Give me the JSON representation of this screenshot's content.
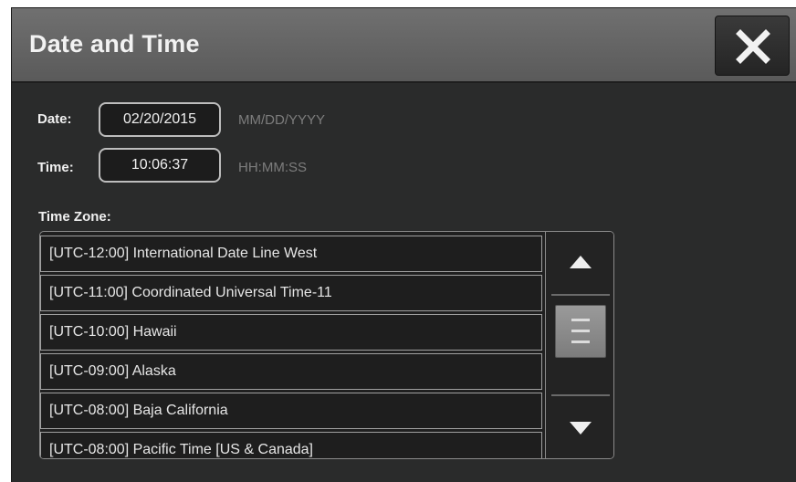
{
  "dialog": {
    "title": "Date and Time",
    "close_icon": "close-icon"
  },
  "date": {
    "label": "Date:",
    "value": "02/20/2015",
    "format_hint": "MM/DD/YYYY"
  },
  "time": {
    "label": "Time:",
    "value": "10:06:37",
    "format_hint": "HH:MM:SS"
  },
  "timezone": {
    "label": "Time Zone:",
    "items": [
      "[UTC-12:00] International Date Line West",
      "[UTC-11:00] Coordinated Universal Time-11",
      "[UTC-10:00] Hawaii",
      "[UTC-09:00] Alaska",
      "[UTC-08:00] Baja California",
      "[UTC-08:00] Pacific Time [US & Canada]"
    ],
    "scroll_up_icon": "arrow-up-icon",
    "scroll_down_icon": "arrow-down-icon"
  },
  "colors": {
    "background": "#2a2b2b",
    "titlebar": "#666666",
    "text": "#f0f0f0",
    "hint": "#7d7d7d"
  }
}
